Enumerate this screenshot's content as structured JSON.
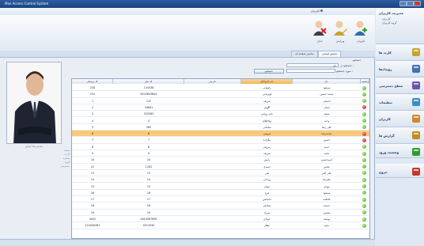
{
  "window": {
    "title": "Man Access Control System"
  },
  "ribbon": {
    "tab_label": "کاربران",
    "buttons": [
      {
        "label": "افزودن",
        "icon": "add-user-icon"
      },
      {
        "label": "ویرایش",
        "icon": "edit-user-icon"
      },
      {
        "label": "حذف",
        "icon": "delete-user-icon"
      }
    ]
  },
  "tabs": {
    "active": "نمایش لیستی",
    "other": "نمایش صفحه ای"
  },
  "search": {
    "title": "جستجو",
    "name_label": "جستجو در :",
    "name_value": "نام",
    "term_label": "مورد جستجو :",
    "button_label": "جستجو"
  },
  "photo": {
    "caption": "محمدرضا خوش"
  },
  "side_labels": [
    "سمت :",
    "کارت :",
    "شماره :",
    "گروه :",
    "دسترسی :"
  ],
  "table": {
    "columns": [
      "وضعیت",
      "نام",
      "نام خانوادگی",
      "نام پدر",
      "کد ملی",
      "کد پرسنلی"
    ],
    "rows": [
      {
        "status": "green",
        "first": "مسعود",
        "last": "رضوانی",
        "father": "",
        "national": "134436",
        "personnel": "230"
      },
      {
        "status": "green",
        "first": "محمد حسین",
        "last": "قهرمانی",
        "father": "",
        "national": "6543643604",
        "personnel": "231"
      },
      {
        "status": "green",
        "first": "احسان",
        "last": "شریف",
        "father": "",
        "national": "122",
        "personnel": "1"
      },
      {
        "status": "red",
        "first": "ایمان",
        "last": "آگهان",
        "father": "",
        "national": "54641",
        "personnel": "2"
      },
      {
        "status": "green",
        "first": "سعید",
        "last": "نجم روشن",
        "father": "",
        "national": "525583",
        "personnel": "3"
      },
      {
        "status": "green",
        "first": "وحید",
        "last": "وفاطلاع",
        "father": "",
        "national": "4",
        "personnel": "4"
      },
      {
        "status": "green",
        "first": "علی رضا",
        "last": "سلمانی",
        "father": "",
        "national": "565",
        "personnel": "5"
      },
      {
        "status": "red",
        "first": "محمدرضا",
        "last": "فروش",
        "father": "",
        "national": "6",
        "personnel": "6",
        "selected": true
      },
      {
        "status": "red",
        "first": "حسین",
        "last": "بیگزاده",
        "father": "",
        "national": "7",
        "personnel": "7"
      },
      {
        "status": "green",
        "first": "حمید",
        "last": "زمرولی",
        "father": "",
        "national": "8",
        "personnel": "8"
      },
      {
        "status": "green",
        "first": "مجید",
        "last": "شریف",
        "father": "",
        "national": "9",
        "personnel": "9"
      },
      {
        "status": "green",
        "first": "امیرحسین",
        "last": "رامین",
        "father": "",
        "national": "10",
        "personnel": "10"
      },
      {
        "status": "green",
        "first": "عباس",
        "last": "حمیدی",
        "father": "",
        "national": "1202",
        "personnel": "12"
      },
      {
        "status": "green",
        "first": "علی اکبر",
        "last": "نقی",
        "father": "",
        "national": "13",
        "personnel": "13"
      },
      {
        "status": "green",
        "first": "علیرضا",
        "last": "روحانی",
        "father": "",
        "national": "14",
        "personnel": "14"
      },
      {
        "status": "green",
        "first": "مهدی",
        "last": "جهان",
        "father": "",
        "national": "15",
        "personnel": "15"
      },
      {
        "status": "green",
        "first": "مسعود",
        "last": "فرج",
        "father": "",
        "national": "16",
        "personnel": "16"
      },
      {
        "status": "green",
        "first": "فاطمه",
        "last": "تاجبخش",
        "father": "",
        "national": "17",
        "personnel": "17"
      },
      {
        "status": "green",
        "first": "حمیده",
        "last": "عبادیان",
        "father": "",
        "national": "18",
        "personnel": "18"
      },
      {
        "status": "green",
        "first": "محسن",
        "last": "نورزاد",
        "father": "",
        "national": "19",
        "personnel": "19"
      },
      {
        "status": "green",
        "first": "یوسف",
        "last": "جوادی",
        "father": "",
        "national": "0024567890",
        "personnel": "4052"
      },
      {
        "status": "green",
        "first": "میثم",
        "last": "عطار",
        "father": "",
        "national": "4521030",
        "personnel": "124450481"
      }
    ]
  },
  "sidebar": {
    "header": {
      "title": "مدیریت کاربران",
      "items": [
        "کاربران",
        "گروه کاربران"
      ]
    },
    "items": [
      {
        "label": "کارت ها",
        "icon": "cards-icon"
      },
      {
        "label": "رویدادها",
        "icon": "events-icon"
      },
      {
        "label": "سطح دسترسی",
        "icon": "access-level-icon"
      },
      {
        "label": "تنظیمات",
        "icon": "settings-icon"
      },
      {
        "label": "کاربران",
        "icon": "users-icon"
      },
      {
        "label": "گزارش ها",
        "icon": "reports-icon"
      },
      {
        "label": "وضعیت ورود",
        "icon": "entry-status-icon"
      },
      {
        "label": "خروج",
        "icon": "exit-icon"
      }
    ]
  },
  "colors": {
    "accent": "#2b5da0",
    "selection": "#fbc97a",
    "status_ok": "#3e9f22",
    "status_off": "#a41d1d"
  }
}
